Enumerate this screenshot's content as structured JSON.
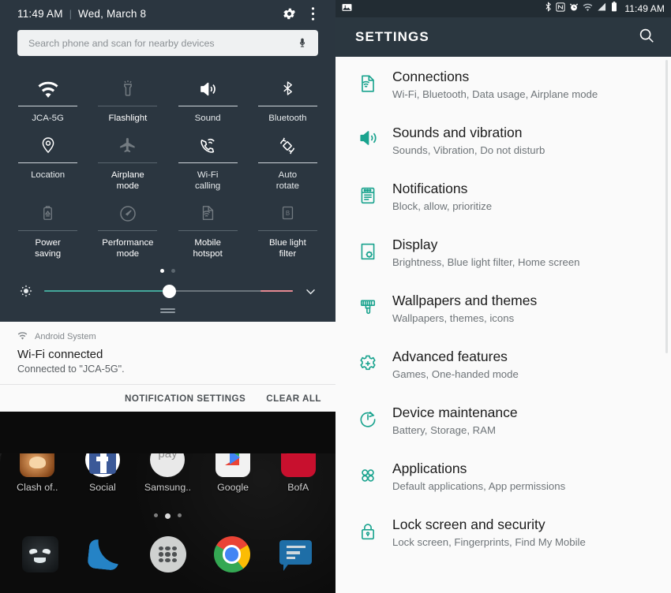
{
  "quick_settings": {
    "time": "11:49 AM",
    "separator": "|",
    "date": "Wed, March 8",
    "gear_icon": "gear-icon",
    "overflow_icon": "more-vertical-icon",
    "search": {
      "placeholder": "Search phone and scan for nearby devices",
      "mic_icon": "microphone-icon"
    },
    "tiles": [
      {
        "label": "JCA-5G",
        "icon": "wifi-icon",
        "enabled": true
      },
      {
        "label": "Flashlight",
        "icon": "flashlight-icon",
        "enabled": false
      },
      {
        "label": "Sound",
        "icon": "volume-icon",
        "enabled": true
      },
      {
        "label": "Bluetooth",
        "icon": "bluetooth-icon",
        "enabled": true
      },
      {
        "label": "Location",
        "icon": "location-pin-icon",
        "enabled": true
      },
      {
        "label": "Airplane\nmode",
        "icon": "airplane-icon",
        "enabled": false
      },
      {
        "label": "Wi-Fi\ncalling",
        "icon": "wifi-calling-icon",
        "enabled": true
      },
      {
        "label": "Auto\nrotate",
        "icon": "auto-rotate-icon",
        "enabled": true
      },
      {
        "label": "Power\nsaving",
        "icon": "battery-saver-icon",
        "enabled": false
      },
      {
        "label": "Performance\nmode",
        "icon": "speedometer-icon",
        "enabled": false
      },
      {
        "label": "Mobile\nhotspot",
        "icon": "hotspot-icon",
        "enabled": false
      },
      {
        "label": "Blue light\nfilter",
        "icon": "blue-light-filter-icon",
        "enabled": false
      }
    ],
    "page_dots": {
      "count": 2,
      "active": 0
    },
    "brightness": {
      "icon": "brightness-icon",
      "value_percent": 50,
      "fill_color": "#44a79a",
      "end_color": "#e68a92",
      "expand_icon": "chevron-down-icon"
    }
  },
  "notification": {
    "app_icon": "wifi-icon",
    "app_name": "Android System",
    "title": "Wi-Fi connected",
    "body": "Connected to \"JCA-5G\".",
    "actions": {
      "settings": "NOTIFICATION SETTINGS",
      "clear_all": "CLEAR ALL"
    }
  },
  "home_screen": {
    "apps": [
      {
        "label": "Clash of..",
        "icon": "clash-of-clans-icon"
      },
      {
        "label": "Social",
        "icon": "facebook-folder-icon"
      },
      {
        "label": "Samsung..",
        "icon": "samsung-pay-icon"
      },
      {
        "label": "Google",
        "icon": "google-play-folder-icon"
      },
      {
        "label": "BofA",
        "icon": "bank-of-america-icon"
      }
    ],
    "page_dots": {
      "count": 3,
      "active": 1
    },
    "dock": [
      {
        "icon": "dark-game-app-icon"
      },
      {
        "icon": "phone-icon"
      },
      {
        "icon": "app-drawer-icon"
      },
      {
        "icon": "chrome-icon"
      },
      {
        "icon": "messages-icon"
      }
    ]
  },
  "settings_screen": {
    "status_bar": {
      "left_icons": [
        "screenshot-icon"
      ],
      "right_icons": [
        "bluetooth-icon",
        "nfc-icon",
        "alarm-icon",
        "wifi-icon",
        "signal-icon",
        "battery-icon"
      ],
      "time": "11:49 AM"
    },
    "app_bar": {
      "title": "SETTINGS",
      "search_icon": "search-icon"
    },
    "items": [
      {
        "title": "Connections",
        "subtitle": "Wi-Fi, Bluetooth, Data usage, Airplane mode",
        "icon": "connections-icon"
      },
      {
        "title": "Sounds and vibration",
        "subtitle": "Sounds, Vibration, Do not disturb",
        "icon": "volume-icon"
      },
      {
        "title": "Notifications",
        "subtitle": "Block, allow, prioritize",
        "icon": "notifications-icon"
      },
      {
        "title": "Display",
        "subtitle": "Brightness, Blue light filter, Home screen",
        "icon": "display-icon"
      },
      {
        "title": "Wallpapers and themes",
        "subtitle": "Wallpapers, themes, icons",
        "icon": "paintbrush-icon"
      },
      {
        "title": "Advanced features",
        "subtitle": "Games, One-handed mode",
        "icon": "advanced-features-icon"
      },
      {
        "title": "Device maintenance",
        "subtitle": "Battery, Storage, RAM",
        "icon": "device-maintenance-icon"
      },
      {
        "title": "Applications",
        "subtitle": "Default applications, App permissions",
        "icon": "applications-icon"
      },
      {
        "title": "Lock screen and security",
        "subtitle": "Lock screen, Fingerprints, Find My Mobile",
        "icon": "lock-icon"
      }
    ],
    "accent_color": "#19a38e"
  }
}
